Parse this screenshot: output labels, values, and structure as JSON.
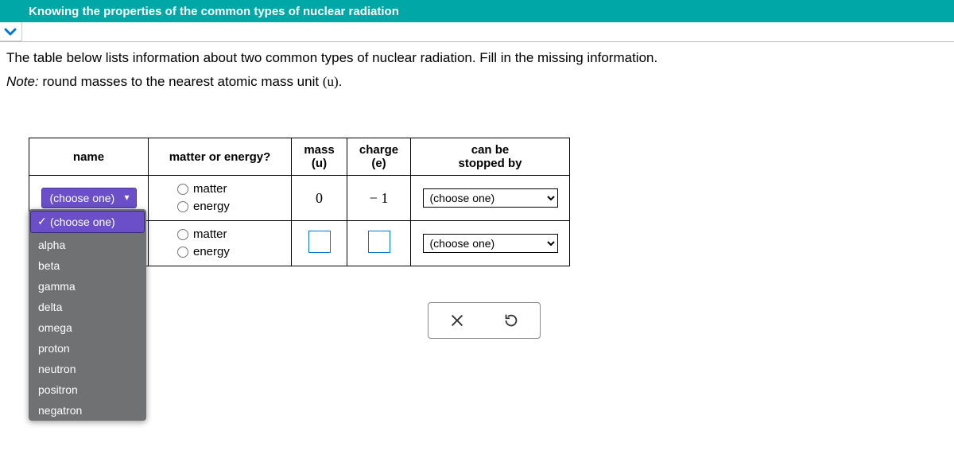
{
  "topbar": {
    "title": "Knowing the properties of the common types of nuclear radiation"
  },
  "prompt": "The table below lists information about two common types of nuclear radiation. Fill in the missing information.",
  "note": {
    "label": "Note:",
    "text": " round masses to the nearest atomic mass unit ",
    "u": "(u)",
    "tail": "."
  },
  "headers": {
    "name": "name",
    "matter_energy": "matter or energy?",
    "mass_top": "mass",
    "mass_bot": "(u)",
    "charge_top": "charge",
    "charge_bot": "(e)",
    "stop_top": "can be",
    "stop_bot": "stopped by"
  },
  "rows": [
    {
      "name_chip": "(choose one)",
      "matter_label": "matter",
      "energy_label": "energy",
      "mass": "0",
      "charge": "− 1",
      "stop_placeholder": "(choose one)"
    },
    {
      "matter_label": "matter",
      "energy_label": "energy",
      "stop_placeholder": "(choose one)"
    }
  ],
  "dropdown": {
    "selected": "(choose one)",
    "options": [
      "alpha",
      "beta",
      "gamma",
      "delta",
      "omega",
      "proton",
      "neutron",
      "positron",
      "negatron"
    ]
  },
  "actions": {
    "close": "×",
    "reset": "↺"
  }
}
